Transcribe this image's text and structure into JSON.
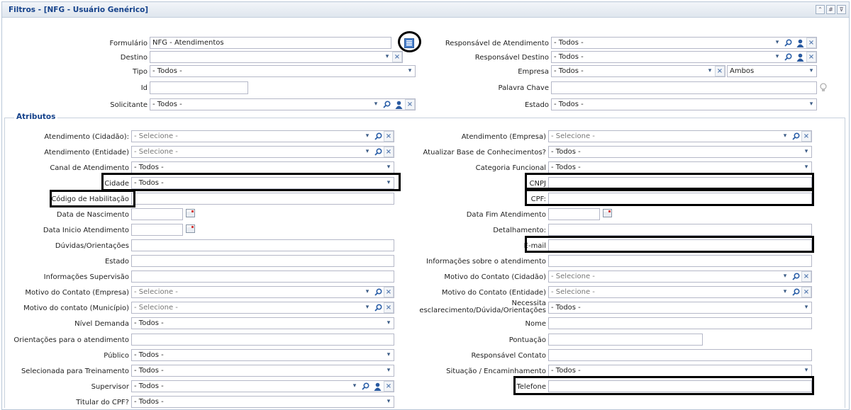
{
  "panel": {
    "title": "Filtros - [NFG - Usuário Genérico]",
    "buttons": [
      "⌃",
      "#",
      "⊽"
    ]
  },
  "top_left": [
    {
      "label": "Formulário",
      "value": "NFG - Atendimentos"
    },
    {
      "label": "Destino",
      "value": ""
    },
    {
      "label": "Tipo",
      "value": "- Todos -"
    },
    {
      "label": "Id",
      "value": ""
    },
    {
      "label": "Solicitante",
      "value": "- Todos -"
    }
  ],
  "top_right": [
    {
      "label": "Responsável de Atendimento",
      "value": "- Todos -"
    },
    {
      "label": "Responsável Destino",
      "value": "- Todos -"
    },
    {
      "label": "Empresa",
      "value": "- Todos -",
      "extra": "Ambos"
    },
    {
      "label": "Palavra Chave",
      "value": ""
    },
    {
      "label": "Estado",
      "value": "- Todos -"
    }
  ],
  "attributes": {
    "legend": "Atributos",
    "left": [
      {
        "label": "Atendimento (Cidadão):",
        "value": "- Selecione -"
      },
      {
        "label": "Atendimento (Entidade)",
        "value": "- Selecione -"
      },
      {
        "label": "Canal de Atendimento",
        "value": "- Todos -"
      },
      {
        "label": "Cidade",
        "value": "- Todos -"
      },
      {
        "label": "Código de Habilitação",
        "value": ""
      },
      {
        "label": "Data de Nascimento",
        "value": ""
      },
      {
        "label": "Data Inicio Atendimento",
        "value": ""
      },
      {
        "label": "Dúvidas/Orientações",
        "value": ""
      },
      {
        "label": "Estado",
        "value": ""
      },
      {
        "label": "Informações Supervisão",
        "value": ""
      },
      {
        "label": "Motivo do Contato (Empresa)",
        "value": "- Selecione -"
      },
      {
        "label": "Motivo do contato (Município)",
        "value": "- Selecione -"
      },
      {
        "label": "Nível Demanda",
        "value": "- Todos -"
      },
      {
        "label": "Orientações para o atendimento",
        "value": ""
      },
      {
        "label": "Público",
        "value": "- Todos -"
      },
      {
        "label": "Selecionada para Treinamento",
        "value": "- Todos -"
      },
      {
        "label": "Supervisor",
        "value": "- Todos -"
      },
      {
        "label": "Titular do CPF?",
        "value": "- Todos -"
      }
    ],
    "right": [
      {
        "label": "Atendimento (Empresa)",
        "value": "- Selecione -"
      },
      {
        "label": "Atualizar Base de Conhecimentos?",
        "value": "- Todos -"
      },
      {
        "label": "Categoria Funcional",
        "value": "- Todos -"
      },
      {
        "label": "CNPJ",
        "value": ""
      },
      {
        "label": "CPF:",
        "value": ""
      },
      {
        "label": "Data Fim Atendimento",
        "value": ""
      },
      {
        "label": "Detalhamento:",
        "value": ""
      },
      {
        "label": "E-mail",
        "value": ""
      },
      {
        "label": "Informações sobre o atendimento",
        "value": ""
      },
      {
        "label": "Motivo do Contato (Cidadão)",
        "value": "- Selecione -"
      },
      {
        "label": "Motivo do Contato (Entidade)",
        "value": "- Selecione -"
      },
      {
        "label_line1": "Necessita",
        "label_line2": "esclarecimento/Dúvida/Orientações",
        "value": "- Todos -"
      },
      {
        "label": "Nome",
        "value": ""
      },
      {
        "label": "Pontuação",
        "value": ""
      },
      {
        "label": "Responsável Contato",
        "value": ""
      },
      {
        "label": "Situação / Encaminhamento",
        "value": "- Todos -"
      },
      {
        "label": "Telefone",
        "value": ""
      }
    ]
  },
  "icons": {
    "dropdown": "▾",
    "clear": "×",
    "search": "search-icon",
    "user": "user-icon",
    "calendar": "calendar-icon",
    "bulb": "lightbulb-icon",
    "grid": "list-grid-icon"
  },
  "colors": {
    "title": "#15428b",
    "border": "#b5b8c8",
    "icon_blue": "#3b5b86"
  }
}
